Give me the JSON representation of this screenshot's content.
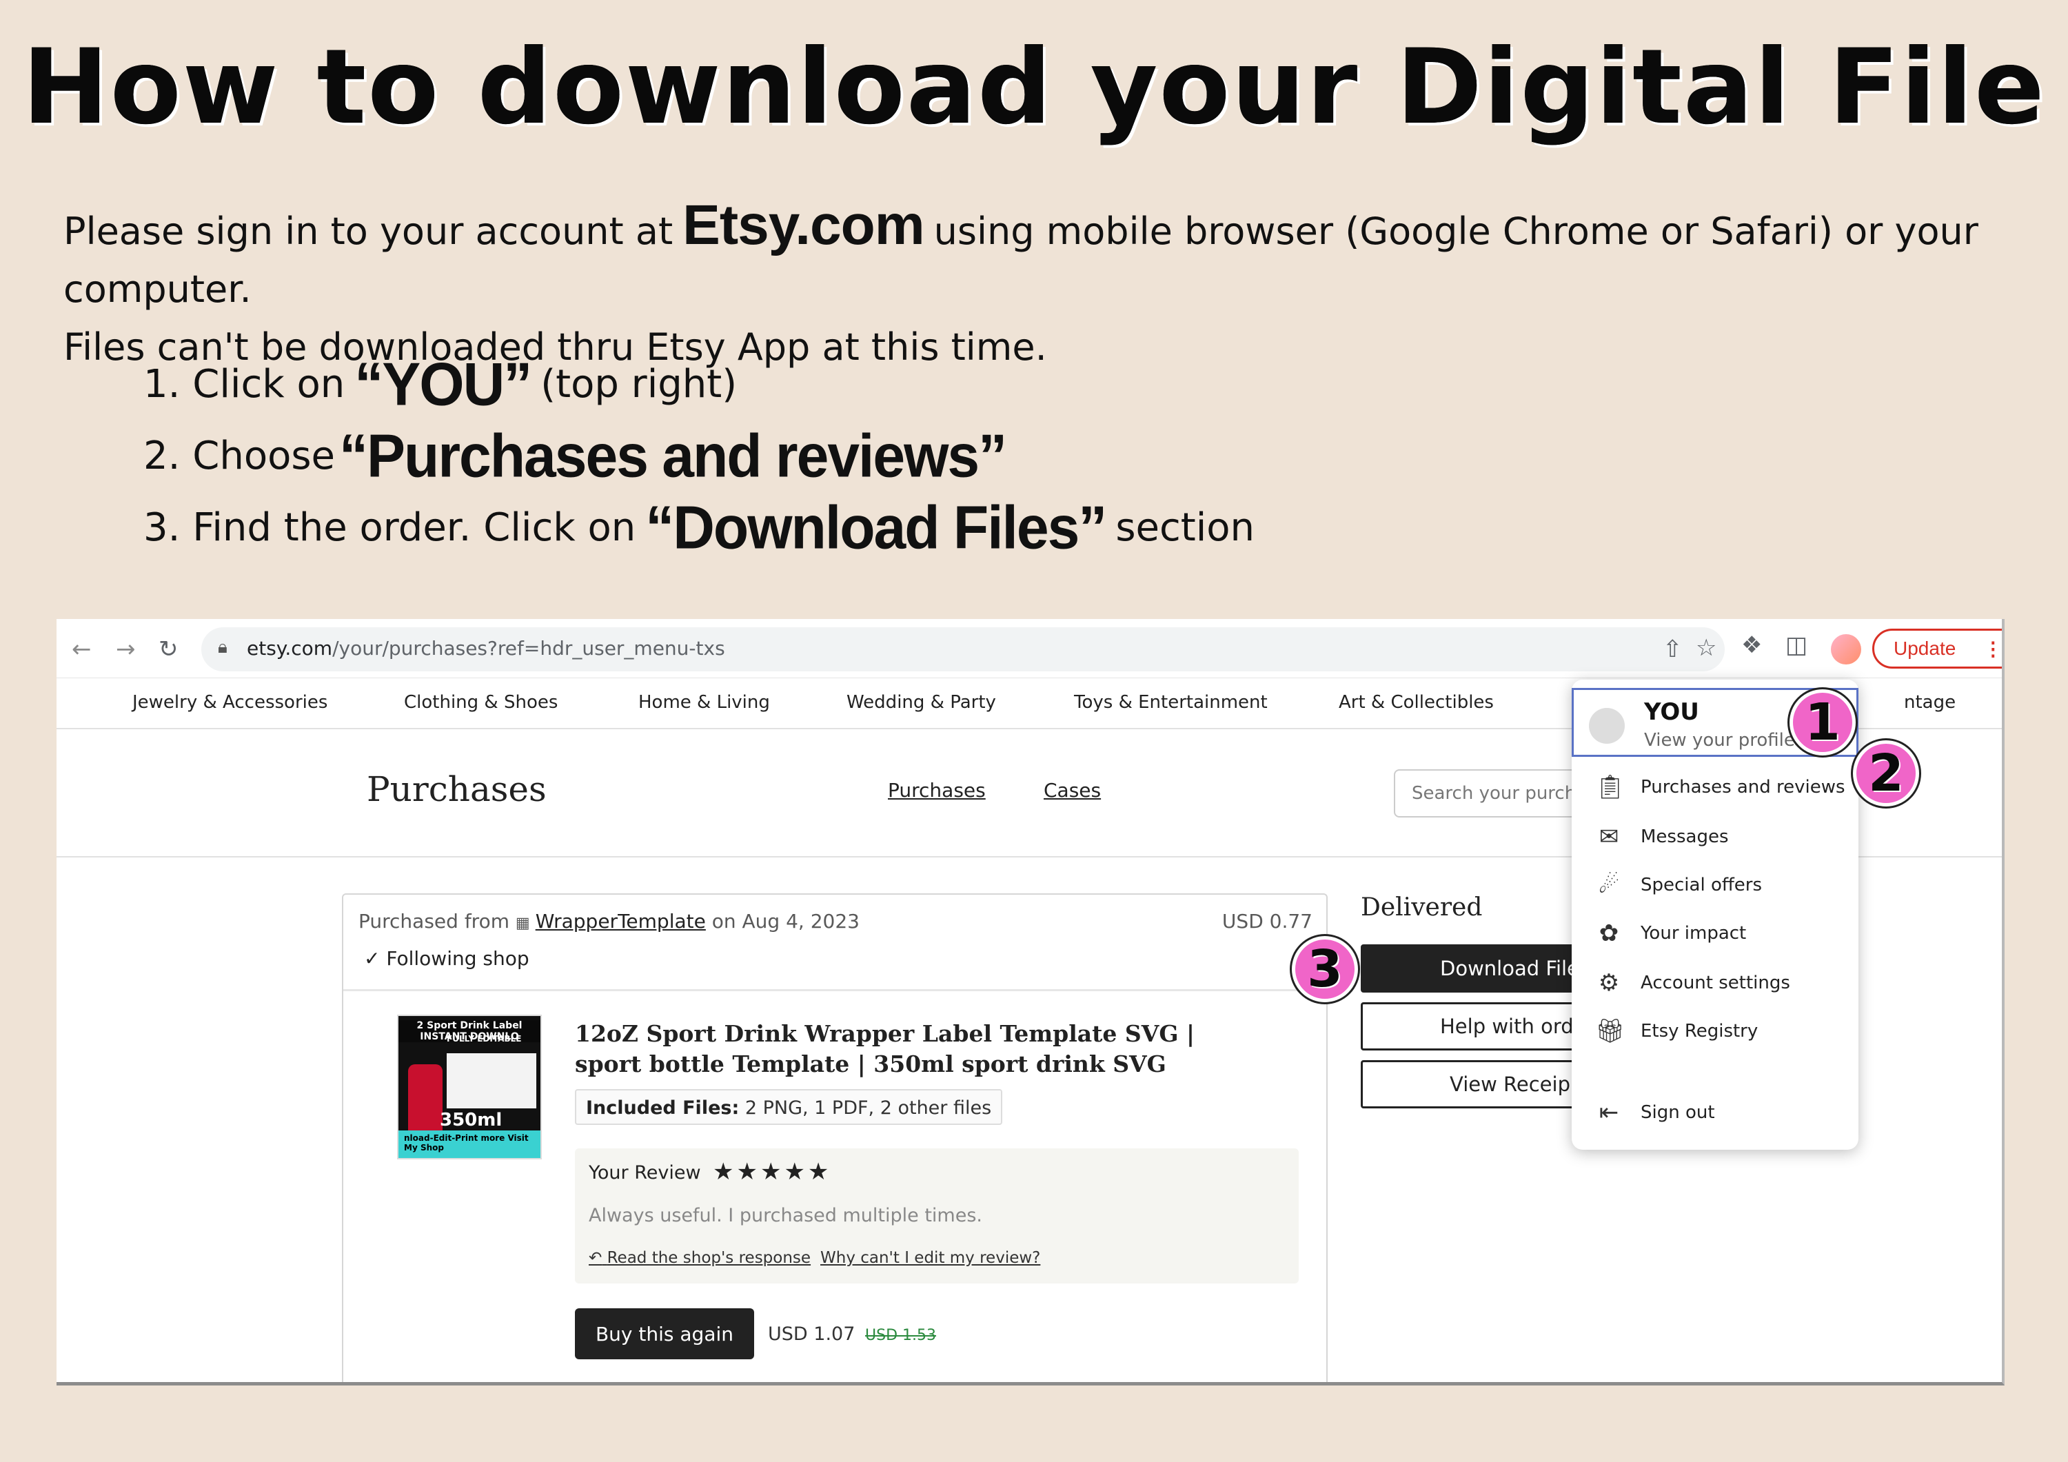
{
  "title": "How to download your Digital File",
  "intro": {
    "before": "Please sign in to your account at",
    "site": "Etsy.com",
    "after": "using mobile browser (Google Chrome or Safari) or your computer.",
    "line2": "Files can't be downloaded thru Etsy App at this time."
  },
  "steps": [
    {
      "pre": "1. Click on",
      "highlight": "“YOU”",
      "post": "(top right)"
    },
    {
      "pre": "2. Choose",
      "highlight": "“Purchases and reviews”",
      "post": ""
    },
    {
      "pre": "3. Find the order. Click on",
      "highlight": "“Download Files”",
      "post": "section"
    }
  ],
  "browser": {
    "url_host": "etsy.com",
    "url_path": "/your/purchases?ref=hdr_user_menu-txs",
    "update_label": "Update",
    "back_icon": "back-arrow-icon",
    "forward_icon": "forward-arrow-icon",
    "reload_icon": "reload-icon"
  },
  "categories": [
    "Jewelry & Accessories",
    "Clothing & Shoes",
    "Home & Living",
    "Wedding & Party",
    "Toys & Entertainment",
    "Art & Collectibles",
    "ntage"
  ],
  "page": {
    "title": "Purchases",
    "tabs": [
      "Purchases",
      "Cases"
    ],
    "search_placeholder": "Search your purcha"
  },
  "order": {
    "purchased_from": "Purchased from",
    "shop": "WrapperTemplate",
    "date": "on Aug 4, 2023",
    "price": "USD 0.77",
    "following": "Following shop",
    "product_title": "12oZ Sport Drink Wrapper Label Template SVG | sport bottle Template | 350ml sport drink SVG",
    "included_label": "Included Files:",
    "included_value": "2 PNG, 1 PDF, 2 other files",
    "review_label": "Your Review",
    "stars": "★★★★★",
    "review_text": "Always useful. I purchased multiple times.",
    "response_link": "Read the shop's response",
    "edit_link": "Why can't I edit my review?",
    "buy_again": "Buy this again",
    "buy_price": "USD 1.07",
    "old_price": "USD 1.53",
    "thumb": {
      "top": "2 Sport Drink Label INSTANT DOWNLO",
      "editable": "FULLY EDITABLE",
      "ml": "350ml",
      "bottom": "nload-Edit-Print more Visit My Shop"
    }
  },
  "status": {
    "delivered": "Delivered",
    "download": "Download File",
    "help": "Help with ord",
    "receipt": "View Receip"
  },
  "menu": {
    "you": "YOU",
    "view_profile": "View your profile",
    "items": [
      "Purchases and reviews",
      "Messages",
      "Special offers",
      "Your impact",
      "Account settings",
      "Etsy Registry",
      "Sign out"
    ]
  },
  "callouts": [
    "1",
    "2",
    "3"
  ]
}
